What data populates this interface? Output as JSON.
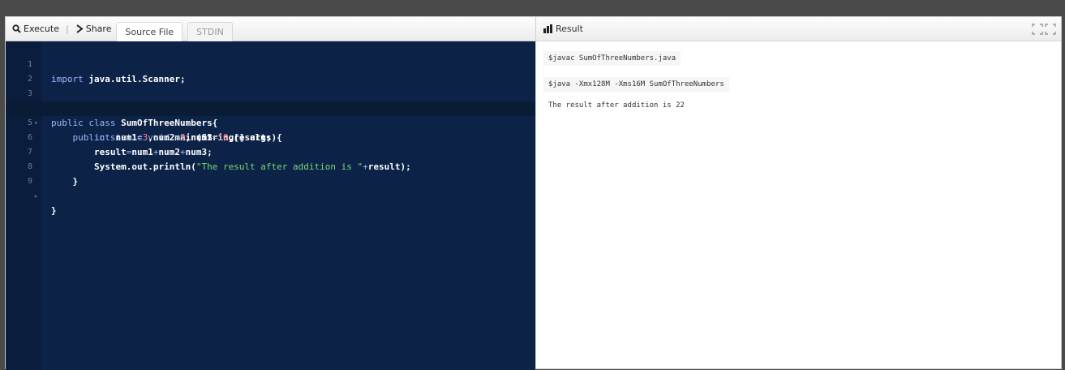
{
  "toolbar": {
    "execute_label": "Execute",
    "share_label": "Share",
    "tabs": [
      "Source File",
      "STDIN"
    ]
  },
  "editor": {
    "lines": [
      {
        "n": "1",
        "text": "import java.util.Scanner;"
      },
      {
        "n": "2",
        "text": ""
      },
      {
        "n": "3",
        "text": "public class SumOfThreeNumbers{"
      },
      {
        "n": "4",
        "text": "    public static void main(String[] args){"
      },
      {
        "n": "5",
        "text": "        int num1=3,num2=9,num3=10,result;"
      },
      {
        "n": "6",
        "text": "        result=num1+num2+num3;"
      },
      {
        "n": "7",
        "text": "        System.out.println(\"The result after addition is \"+result);"
      },
      {
        "n": "8",
        "text": "    }"
      },
      {
        "n": "9",
        "text": "}"
      }
    ],
    "highlighted_line": 5,
    "colors": {
      "background": "#0c2347",
      "keyword": "#9db5ff",
      "string": "#78d878",
      "number": "#ff8c8c"
    }
  },
  "result": {
    "title": "Result",
    "compile_cmd": "$javac SumOfThreeNumbers.java",
    "run_cmd": "$java -Xmx128M -Xms16M SumOfThreeNumbers",
    "output": "The result after addition is 22"
  }
}
